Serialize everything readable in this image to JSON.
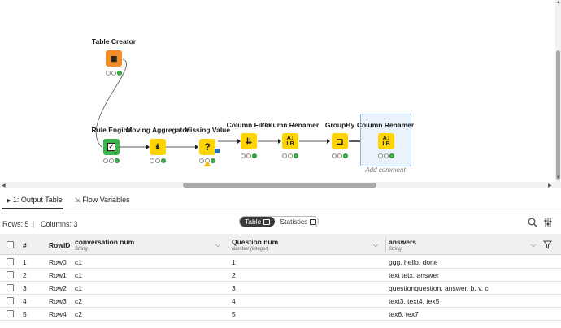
{
  "workflow": {
    "nodes": [
      {
        "id": "table-creator",
        "label": "Table Creator",
        "icon": "table-icon",
        "color": "#f28c28"
      },
      {
        "id": "rule-engine",
        "label": "Rule Engine",
        "icon": "rule-icon",
        "color": "#3bb24a"
      },
      {
        "id": "moving-aggregator",
        "label": "Moving Aggregator",
        "icon": "aggregator-icon",
        "color": "#ffd400"
      },
      {
        "id": "missing-value",
        "label": "Missing Value",
        "icon": "question-icon",
        "color": "#ffd400",
        "glyph": "?"
      },
      {
        "id": "column-filter",
        "label": "Column Filter",
        "icon": "filter-icon",
        "color": "#ffd400"
      },
      {
        "id": "column-renamer-1",
        "label": "Column Renamer",
        "icon": "renamer-icon",
        "color": "#ffd400"
      },
      {
        "id": "groupby",
        "label": "GroupBy",
        "icon": "groupby-icon",
        "color": "#ffd400"
      },
      {
        "id": "column-renamer-2",
        "label": "Column Renamer",
        "icon": "renamer-icon",
        "color": "#ffd400"
      }
    ],
    "selected_comment": "Add comment"
  },
  "tabs": {
    "output_table": "1: Output Table",
    "flow_variables": "Flow Variables"
  },
  "info": {
    "rows": "Rows: 5",
    "separator": "|",
    "columns": "Columns: 3"
  },
  "view_toggle": {
    "table": "Table",
    "statistics": "Statistics"
  },
  "table": {
    "headers": {
      "index": "#",
      "rowid": "RowID",
      "col1": "conversation num",
      "col1_type": "String",
      "col2": "Question num",
      "col2_type": "Number (integer)",
      "col3": "answers",
      "col3_type": "String"
    },
    "rows": [
      {
        "index": "1",
        "rowid": "Row0",
        "c1": "c1",
        "c2": "1",
        "c3": "ggg, hello, done"
      },
      {
        "index": "2",
        "rowid": "Row1",
        "c1": "c1",
        "c2": "2",
        "c3": "text tetx, answer"
      },
      {
        "index": "3",
        "rowid": "Row2",
        "c1": "c1",
        "c2": "3",
        "c3": "questionquestion, answer, b, v, c"
      },
      {
        "index": "4",
        "rowid": "Row3",
        "c1": "c2",
        "c2": "4",
        "c3": "text3, text4, tex5"
      },
      {
        "index": "5",
        "rowid": "Row4",
        "c1": "c2",
        "c2": "5",
        "c3": "tex6, tex7"
      }
    ]
  }
}
